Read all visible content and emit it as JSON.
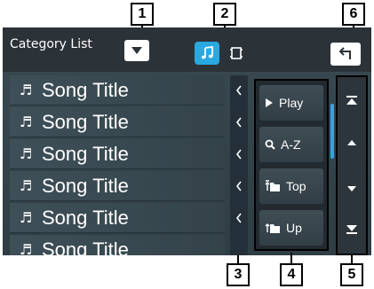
{
  "callouts": [
    "1",
    "2",
    "3",
    "4",
    "5",
    "6"
  ],
  "header": {
    "title": "Category List",
    "dropdown_icon": "triangle-down-icon",
    "source_music_icon": "music-note-icon",
    "source_video_icon": "video-icon",
    "back_icon": "return-arrow-icon"
  },
  "list": {
    "items": [
      {
        "icon": "music-note-icon",
        "label": "Song Title"
      },
      {
        "icon": "music-note-icon",
        "label": "Song Title"
      },
      {
        "icon": "music-note-icon",
        "label": "Song Title"
      },
      {
        "icon": "music-note-icon",
        "label": "Song Title"
      },
      {
        "icon": "music-note-icon",
        "label": "Song Title"
      },
      {
        "icon": "music-note-icon",
        "label": "Song Title"
      }
    ]
  },
  "actions": [
    {
      "icon": "play-icon",
      "label": "Play"
    },
    {
      "icon": "search-icon",
      "label": "A-Z"
    },
    {
      "icon": "folder-top-icon",
      "label": "Top"
    },
    {
      "icon": "folder-up-icon",
      "label": "Up"
    }
  ],
  "scroll_buttons": [
    "scroll-top-icon",
    "scroll-up-icon",
    "scroll-down-icon",
    "scroll-bottom-icon"
  ],
  "colors": {
    "accent": "#2aa8e0",
    "screen_bg": "#34434a",
    "header_bg": "#2c3338"
  }
}
